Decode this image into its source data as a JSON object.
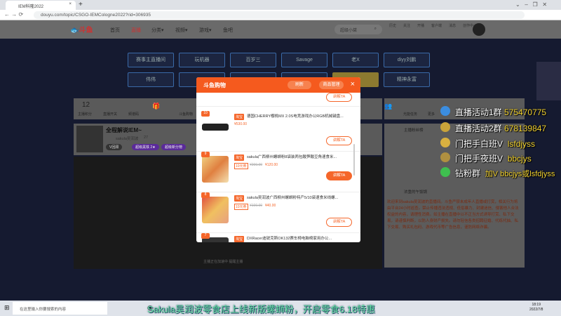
{
  "browser": {
    "tab_title": "IEM科隆2022",
    "url": "douyu.com/topic/CSGO-IEMCologne2022?rid=306935"
  },
  "site": {
    "logo": "斗鱼",
    "nav": [
      "首页",
      "直播",
      "分类▾",
      "视频▾",
      "游戏▾",
      "鱼吧"
    ],
    "search_placeholder": "超级小桀",
    "icons": [
      "历史",
      "关注",
      "开播",
      "客户端",
      "消息",
      "创作中心"
    ]
  },
  "grid": {
    "row1": [
      "赛事主直播间",
      "玩机器",
      "百岁三",
      "Savage",
      "老X",
      "diyy刘鹏"
    ],
    "row2": [
      "伟伟",
      "",
      "",
      "",
      "",
      "精神永富"
    ]
  },
  "toolbar": {
    "score": "12",
    "score_label": "主播积分",
    "items": [
      "直播开关",
      "频谱码",
      "",
      "斗鱼购物"
    ],
    "right_items": [
      "",
      "光能任务",
      "更多"
    ]
  },
  "streamer": {
    "title": "全程解说IEM~",
    "name": "sakula吴润波",
    "hot": "27",
    "badges": [
      "V回顾",
      "超级黑铁 2★",
      "超级新分榜"
    ]
  },
  "shop": {
    "title": "斗鱼购物",
    "btn1": "刷新",
    "btn2": "商品管理",
    "ask": "讲解TA",
    "items": [
      {
        "rank": "10",
        "tag": "淘宝",
        "title": "德国CHERRY樱桃MX 2.0S电竞游戏办公RGB机械键盘...",
        "coupon": "",
        "old": "",
        "price": "¥530.00"
      },
      {
        "rank": "9",
        "tag": "淘宝",
        "title": "sakula广西柳州螺蛳粉8袋装两包酸笋酸豆角速食米...",
        "coupon": "10元券",
        "old": "¥200.00",
        "price": "¥120.00"
      },
      {
        "rank": "8",
        "tag": "淘宝",
        "title": "sakula吴润波广西柳州螺蛳粉特产5/10袋速食米线螺...",
        "coupon": "10元券",
        "old": "¥100.00",
        "price": "¥40.00"
      },
      {
        "rank": "7",
        "tag": "淘宝",
        "title": "DXRacer迪锐克斯OK132赛车椅电脑椅家用办公...",
        "coupon": "",
        "old": "",
        "price": ""
      }
    ]
  },
  "chat": {
    "tab": "主播粉丝榜",
    "user": "浓重的午饭锅",
    "notice": "欢迎来到sakula吴润波的直播间。斗鱼严禁未成年人直播或打赏，相关行为将由平台24小时巡查。禁止传播违法违规、低俗暴力、封建迷信、侵害他人合法权益的内容，请理性消费。如主播在直播中以不正当方式诱导打赏、私下交易，请谨慎判断，以防人身财产损失。请勿轻信各类招聘征婚、代练代抽、私下交易、购买礼包码、游戏代币等广告信息，谨防网络诈骗。"
  },
  "overlay": [
    {
      "label": "直播活动1群",
      "value": "575470775",
      "color": "#3b8de0"
    },
    {
      "label": "直播活动2群",
      "value": "678139847",
      "color": "#c9a33a"
    },
    {
      "label": "门把手白班V",
      "value": "lsfdjyss",
      "color": "#d8b040"
    },
    {
      "label": "门把手夜班V",
      "value": "bbcjys",
      "color": "#b09040"
    },
    {
      "label": "钻粉群",
      "value": "加V bbcjys或lsfdjyss",
      "color": "#3fbf4f"
    }
  ],
  "subtitle": "Sakula吴润波零食店上线新版螺蛳粉，开启零食6.18特惠",
  "video_footer": "主播正在加速中    提醒主播",
  "taskbar": {
    "search": "在这里输入你要搜索的内容",
    "time": "18:19",
    "date": "2022/7/8"
  }
}
